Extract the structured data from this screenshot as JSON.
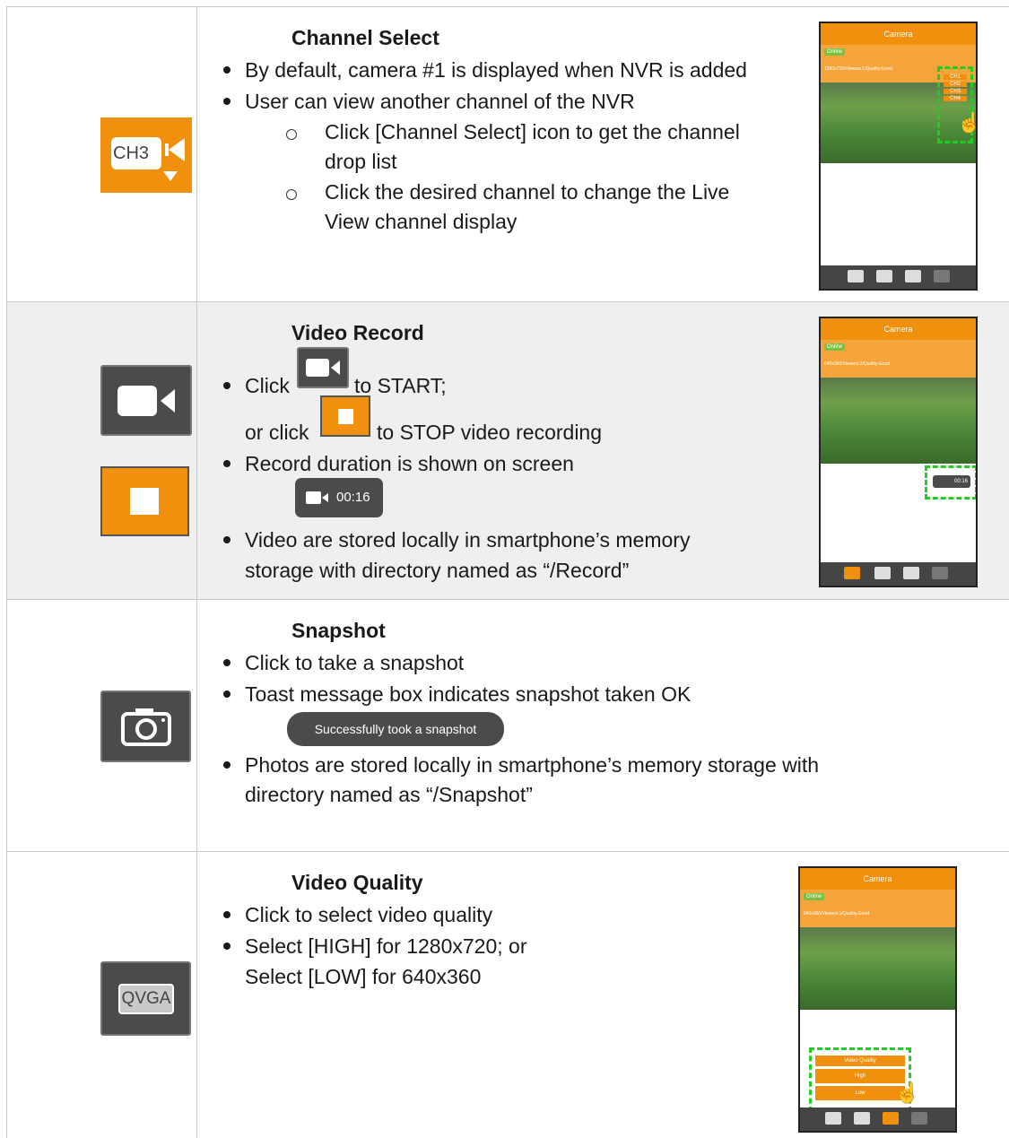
{
  "sections": [
    {
      "title": "Channel Select",
      "icon_label": "CH3",
      "bullets": [
        "By default, camera #1 is displayed when NVR is added",
        "User can view another channel of the NVR"
      ],
      "sub_bullets": [
        [
          "Click [Channel Select] icon to get the channel",
          "drop list"
        ],
        [
          "Click the desired channel to change the Live",
          "View channel display"
        ]
      ],
      "screenshot": {
        "header": "Camera",
        "online": "Online",
        "info": "1280x720/Viewers:1/Quality:Good",
        "channels": [
          "CH1",
          "CH2",
          "CH3",
          "CH4"
        ]
      }
    },
    {
      "title": "Video Record",
      "bullets": {
        "click": "Click",
        "to_start": "to START;",
        "or_click": "or click",
        "to_stop": "to STOP video recording",
        "duration": "Record duration is shown on screen",
        "stored_1": "Video are stored locally in smartphone’s memory",
        "stored_2": "storage with directory named as “/Record”"
      },
      "timer": "00:16",
      "screenshot": {
        "header": "Camera",
        "online": "Online",
        "info": "640x360/Viewers:2/Quality:Good",
        "timer": "00:16"
      }
    },
    {
      "title": "Snapshot",
      "bullets": [
        "Click to take a snapshot",
        "Toast message box indicates snapshot taken OK"
      ],
      "toast": "Successfully took a snapshot",
      "bullets_after": [
        "Photos are stored locally in smartphone’s memory storage with",
        "directory named as “/Snapshot”"
      ]
    },
    {
      "title": "Video Quality",
      "icon_label": "QVGA",
      "bullets": [
        "Click to select video quality",
        "Select [HIGH] for 1280x720; or",
        "Select [LOW] for 640x360"
      ],
      "screenshot": {
        "header": "Camera",
        "online": "Online",
        "info": "640x360/Viewers:1/Quality:Good",
        "menu": [
          "Video Quality",
          "High",
          "Low"
        ]
      }
    }
  ],
  "colors": {
    "accent": "#f0900c",
    "dark_icon": "#4b4b4b",
    "highlight": "#22cc22"
  }
}
